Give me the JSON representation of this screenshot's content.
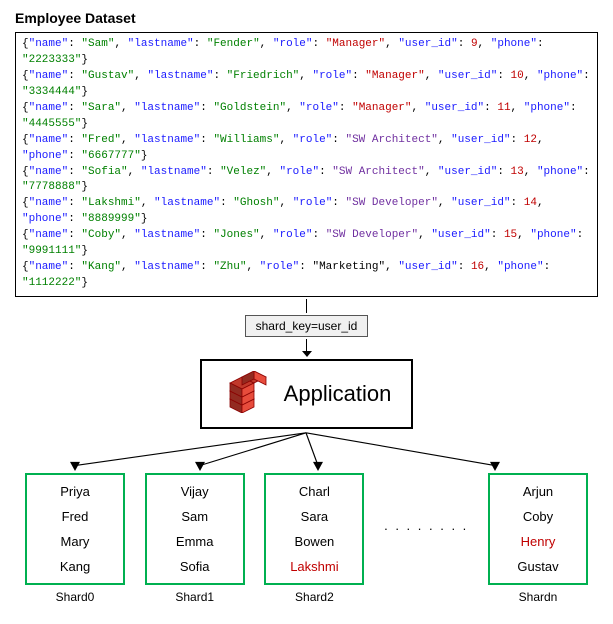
{
  "title": "Employee Dataset",
  "dataset": [
    {
      "raw": "{\"name\": \"Sam\", \"lastname\": \"Fender\", \"role\": \"Manager\", \"user_id\": 9, \"phone\": \"2223333\"}",
      "parts": [
        {
          "text": "{\"name\": \"",
          "type": "plain"
        },
        {
          "text": "Sam",
          "type": "val-str"
        },
        {
          "text": "\", \"lastname\": \"",
          "type": "plain"
        },
        {
          "text": "Fender",
          "type": "val-str"
        },
        {
          "text": "\", \"role\": \"",
          "type": "plain"
        },
        {
          "text": "Manager",
          "type": "role-mgr"
        },
        {
          "text": "\", \"user_id\": ",
          "type": "plain"
        },
        {
          "text": "9",
          "type": "val-num"
        },
        {
          "text": ", \"phone\": \"",
          "type": "plain"
        },
        {
          "text": "2223333",
          "type": "val-str"
        },
        {
          "text": "\"}",
          "type": "plain"
        }
      ]
    }
  ],
  "dataset_lines": [
    "{\"name\": \"Sam\", \"lastname\": \"Fender\", \"role\": \"Manager\", \"user_id\": 9,  \"phone\": \"2223333\"}",
    "{\"name\": \"Gustav\", \"lastname\": \"Friedrich\", \"role\": \"Manager\", \"user_id\": 10, \"phone\": \"3334444\"}",
    "{\"name\": \"Sara\", \"lastname\": \"Goldstein\", \"role\": \"Manager\", \"user_id\": 11, \"phone\": \"4445555\"}",
    "{\"name\": \"Fred\", \"lastname\": \"Williams\", \"role\": \"SW Architect\", \"user_id\": 12, \"phone\": \"6667777\"}",
    "{\"name\": \"Sofia\", \"lastname\": \"Velez\", \"role\": \"SW Architect\", \"user_id\": 13, \"phone\": \"7778888\"}",
    "{\"name\": \"Lakshmi\", \"lastname\": \"Ghosh\", \"role\": \"SW Developer\", \"user_id\": 14, \"phone\": \"8889999\"}",
    "{\"name\": \"Coby\", \"lastname\": \"Jones\", \"role\": \"SW Developer\", \"user_id\": 15, \"phone\": \"9991111\"}",
    "{\"name\": \"Kang\", \"lastname\": \"Zhu\", \"role\": \"Marketing\", \"user_id\": 16, \"phone\": \"1112222\"}"
  ],
  "shard_key_label": "shard_key=user_id",
  "application_label": "Application",
  "shards": [
    {
      "name": "Shard0",
      "items": [
        "Priya",
        "Fred",
        "Mary",
        "Kang"
      ],
      "item_colors": [
        "black",
        "black",
        "black",
        "black"
      ]
    },
    {
      "name": "Shard1",
      "items": [
        "Vijay",
        "Sam",
        "Emma",
        "Sofia"
      ],
      "item_colors": [
        "black",
        "black",
        "black",
        "black"
      ]
    },
    {
      "name": "Shard2",
      "items": [
        "Charl",
        "Sara",
        "Bowen",
        "Lakshmi"
      ],
      "item_colors": [
        "black",
        "black",
        "black",
        "red"
      ]
    },
    {
      "name": "Shardn",
      "items": [
        "Arjun",
        "Coby",
        "Henry",
        "Gustav"
      ],
      "item_colors": [
        "black",
        "black",
        "red",
        "black"
      ]
    }
  ]
}
